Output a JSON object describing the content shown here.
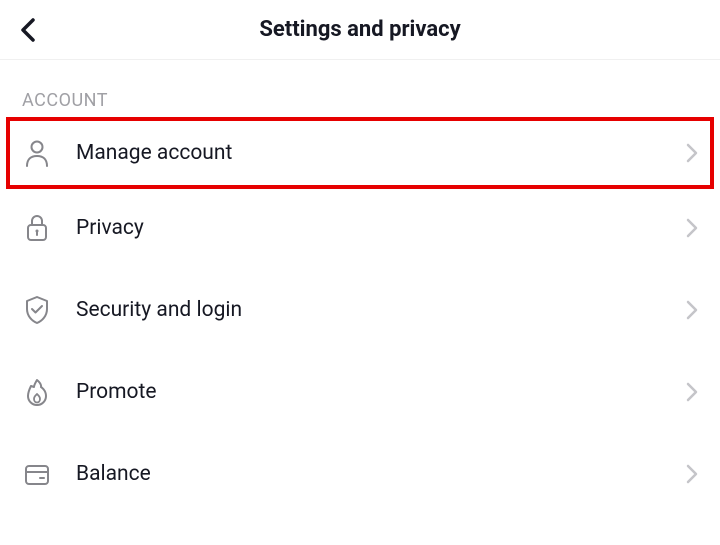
{
  "header": {
    "title": "Settings and privacy"
  },
  "section": {
    "label": "ACCOUNT",
    "items": [
      {
        "label": "Manage account"
      },
      {
        "label": "Privacy"
      },
      {
        "label": "Security and login"
      },
      {
        "label": "Promote"
      },
      {
        "label": "Balance"
      }
    ]
  }
}
